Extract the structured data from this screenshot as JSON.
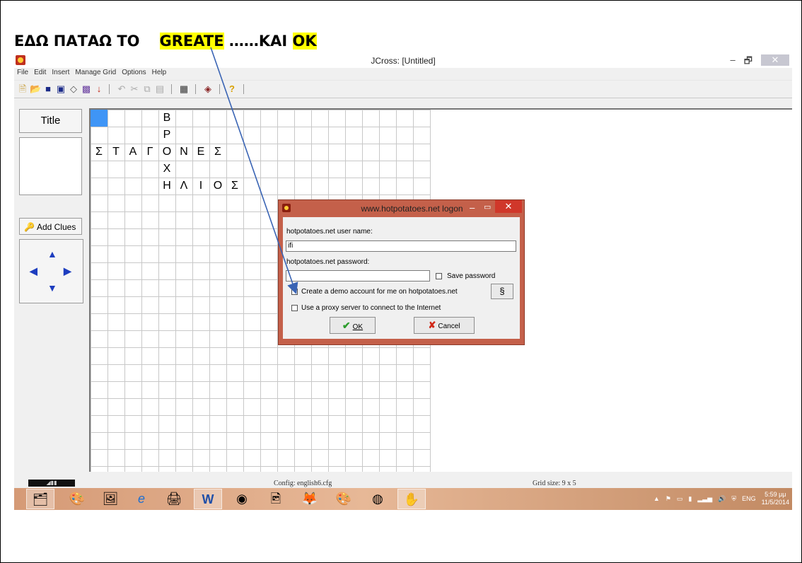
{
  "caption": {
    "part1": "ΕΔΩ ΠΑΤΑΩ  ΤΟ",
    "highlight1": "GREATE",
    "part2": " ……ΚΑΙ ",
    "highlight2": "OK"
  },
  "window": {
    "title": "JCross: [Untitled]",
    "controls": {
      "minimize": "–",
      "restore": "🗗",
      "close": "✕"
    }
  },
  "menu": [
    "File",
    "Edit",
    "Insert",
    "Manage Grid",
    "Options",
    "Help"
  ],
  "toolbar": {
    "icons": [
      "new-file-icon",
      "open-folder-icon",
      "save-icon",
      "save-as-icon",
      "eraser-icon",
      "grid-pattern-icon",
      "arrow-down-icon",
      "undo-icon",
      "cut-icon",
      "copy-icon",
      "paste-icon",
      "automatic-grid-icon",
      "export-web-icon",
      "help-icon"
    ]
  },
  "sidebar": {
    "title_button": "Title",
    "add_clues_button": "Add Clues"
  },
  "grid": {
    "cols": 20,
    "rows": 21,
    "selected_cell": [
      0,
      0
    ],
    "letters": [
      {
        "r": 0,
        "c": 4,
        "ch": "Β"
      },
      {
        "r": 1,
        "c": 4,
        "ch": "Ρ"
      },
      {
        "r": 2,
        "c": 0,
        "ch": "Σ"
      },
      {
        "r": 2,
        "c": 1,
        "ch": "Τ"
      },
      {
        "r": 2,
        "c": 2,
        "ch": "Α"
      },
      {
        "r": 2,
        "c": 3,
        "ch": "Γ"
      },
      {
        "r": 2,
        "c": 4,
        "ch": "Ο"
      },
      {
        "r": 2,
        "c": 5,
        "ch": "Ν"
      },
      {
        "r": 2,
        "c": 6,
        "ch": "Ε"
      },
      {
        "r": 2,
        "c": 7,
        "ch": "Σ"
      },
      {
        "r": 3,
        "c": 4,
        "ch": "Χ"
      },
      {
        "r": 4,
        "c": 4,
        "ch": "Η"
      },
      {
        "r": 4,
        "c": 5,
        "ch": "Λ"
      },
      {
        "r": 4,
        "c": 6,
        "ch": "Ι"
      },
      {
        "r": 4,
        "c": 7,
        "ch": "Ο"
      },
      {
        "r": 4,
        "c": 8,
        "ch": "Σ"
      }
    ]
  },
  "status": {
    "config": "Config: english6.cfg",
    "grid_size": "Grid size: 9 x 5"
  },
  "taskbar": {
    "apps": [
      "file-explorer-icon",
      "paint-icon",
      "media-icon",
      "internet-explorer-icon",
      "scanner-icon",
      "word-icon",
      "chrome-icon",
      "photo-icon",
      "firefox-icon",
      "paint-palette-icon",
      "media-player-icon",
      "hot-potatoes-icon"
    ],
    "tray_lang": "ENG",
    "time": "5:59 μμ",
    "date": "11/5/2014"
  },
  "dialog": {
    "title": "www.hotpotatoes.net logon",
    "username_label": "hotpotatoes.net user name:",
    "username_value": "ifi",
    "password_label": "hotpotatoes.net password:",
    "password_value": "",
    "save_password_label": "Save password",
    "create_demo_label": "Create a demo account for me on hotpotatoes.net",
    "proxy_label": "Use a proxy server to connect to the Internet",
    "ok_label": "OK",
    "cancel_label": "Cancel"
  },
  "colors": {
    "highlight": "#ffff00",
    "selected_cell": "#3f95f6",
    "dialog_frame": "#c4604a",
    "annotation_arrow": "#3a64b4"
  }
}
